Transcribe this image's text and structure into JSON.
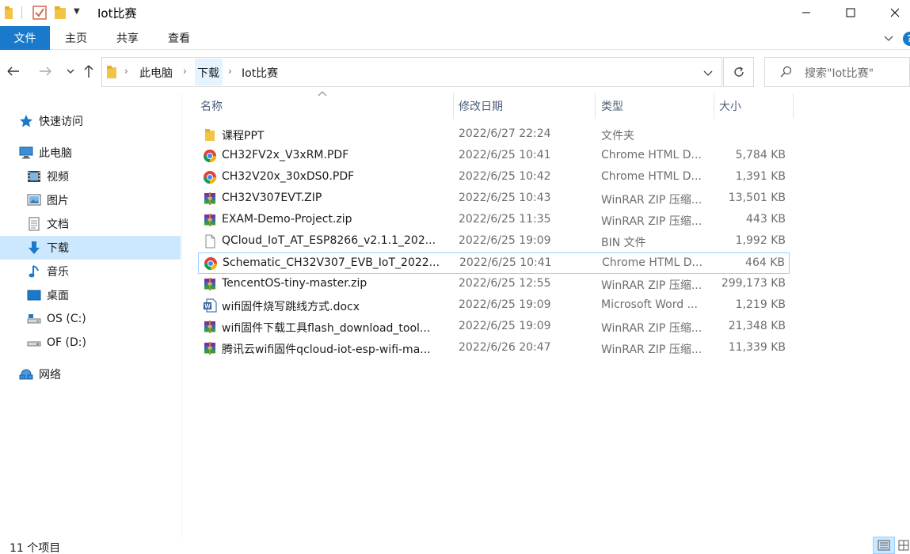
{
  "window": {
    "title": "Iot比赛"
  },
  "ribbon": {
    "tabs": [
      "文件",
      "主页",
      "共享",
      "查看"
    ],
    "accent_color": "#1979ca",
    "help_label": "?"
  },
  "address": {
    "crumbs": [
      "此电脑",
      "下载",
      "Iot比赛"
    ],
    "search_placeholder": "搜索\"Iot比赛\""
  },
  "sidebar": {
    "items": [
      {
        "label": "快速访问",
        "icon": "star-icon"
      },
      {
        "label": "此电脑",
        "icon": "computer-icon"
      },
      {
        "label": "视频",
        "icon": "video-folder-icon"
      },
      {
        "label": "图片",
        "icon": "pictures-folder-icon"
      },
      {
        "label": "文档",
        "icon": "documents-folder-icon"
      },
      {
        "label": "下载",
        "icon": "download-arrow-icon",
        "selected": true
      },
      {
        "label": "音乐",
        "icon": "music-note-icon"
      },
      {
        "label": "桌面",
        "icon": "desktop-icon"
      },
      {
        "label": "OS (C:)",
        "icon": "drive-icon"
      },
      {
        "label": "OF (D:)",
        "icon": "drive-icon"
      },
      {
        "label": "网络",
        "icon": "network-icon"
      }
    ]
  },
  "columns": {
    "name": "名称",
    "date": "修改日期",
    "type": "类型",
    "size": "大小"
  },
  "files": [
    {
      "name": "课程PPT",
      "date": "2022/6/27 22:24",
      "type": "文件夹",
      "size": "",
      "icon": "folder-icon"
    },
    {
      "name": "CH32FV2x_V3xRM.PDF",
      "date": "2022/6/25 10:41",
      "type": "Chrome HTML D...",
      "size": "5,784 KB",
      "icon": "chrome-icon"
    },
    {
      "name": "CH32V20x_30xDS0.PDF",
      "date": "2022/6/25 10:42",
      "type": "Chrome HTML D...",
      "size": "1,391 KB",
      "icon": "chrome-icon"
    },
    {
      "name": "CH32V307EVT.ZIP",
      "date": "2022/6/25 10:43",
      "type": "WinRAR ZIP 压缩...",
      "size": "13,501 KB",
      "icon": "winrar-icon"
    },
    {
      "name": "EXAM-Demo-Project.zip",
      "date": "2022/6/25 11:35",
      "type": "WinRAR ZIP 压缩...",
      "size": "443 KB",
      "icon": "winrar-icon"
    },
    {
      "name": "QCloud_IoT_AT_ESP8266_v2.1.1_202...",
      "date": "2022/6/25 19:09",
      "type": "BIN 文件",
      "size": "1,992 KB",
      "icon": "blank-file-icon"
    },
    {
      "name": "Schematic_CH32V307_EVB_IoT_2022...",
      "date": "2022/6/25 10:41",
      "type": "Chrome HTML D...",
      "size": "464 KB",
      "icon": "chrome-icon",
      "selected": true
    },
    {
      "name": "TencentOS-tiny-master.zip",
      "date": "2022/6/25 12:55",
      "type": "WinRAR ZIP 压缩...",
      "size": "299,173 KB",
      "icon": "winrar-icon"
    },
    {
      "name": "wifi固件烧写跳线方式.docx",
      "date": "2022/6/25 19:09",
      "type": "Microsoft Word ...",
      "size": "1,219 KB",
      "icon": "word-icon"
    },
    {
      "name": "wifi固件下载工具flash_download_tool...",
      "date": "2022/6/25 19:09",
      "type": "WinRAR ZIP 压缩...",
      "size": "21,348 KB",
      "icon": "winrar-icon"
    },
    {
      "name": "腾讯云wifi固件qcloud-iot-esp-wifi-ma...",
      "date": "2022/6/26 20:47",
      "type": "WinRAR ZIP 压缩...",
      "size": "11,339 KB",
      "icon": "winrar-icon"
    }
  ],
  "status": {
    "count": "11 个项目"
  }
}
